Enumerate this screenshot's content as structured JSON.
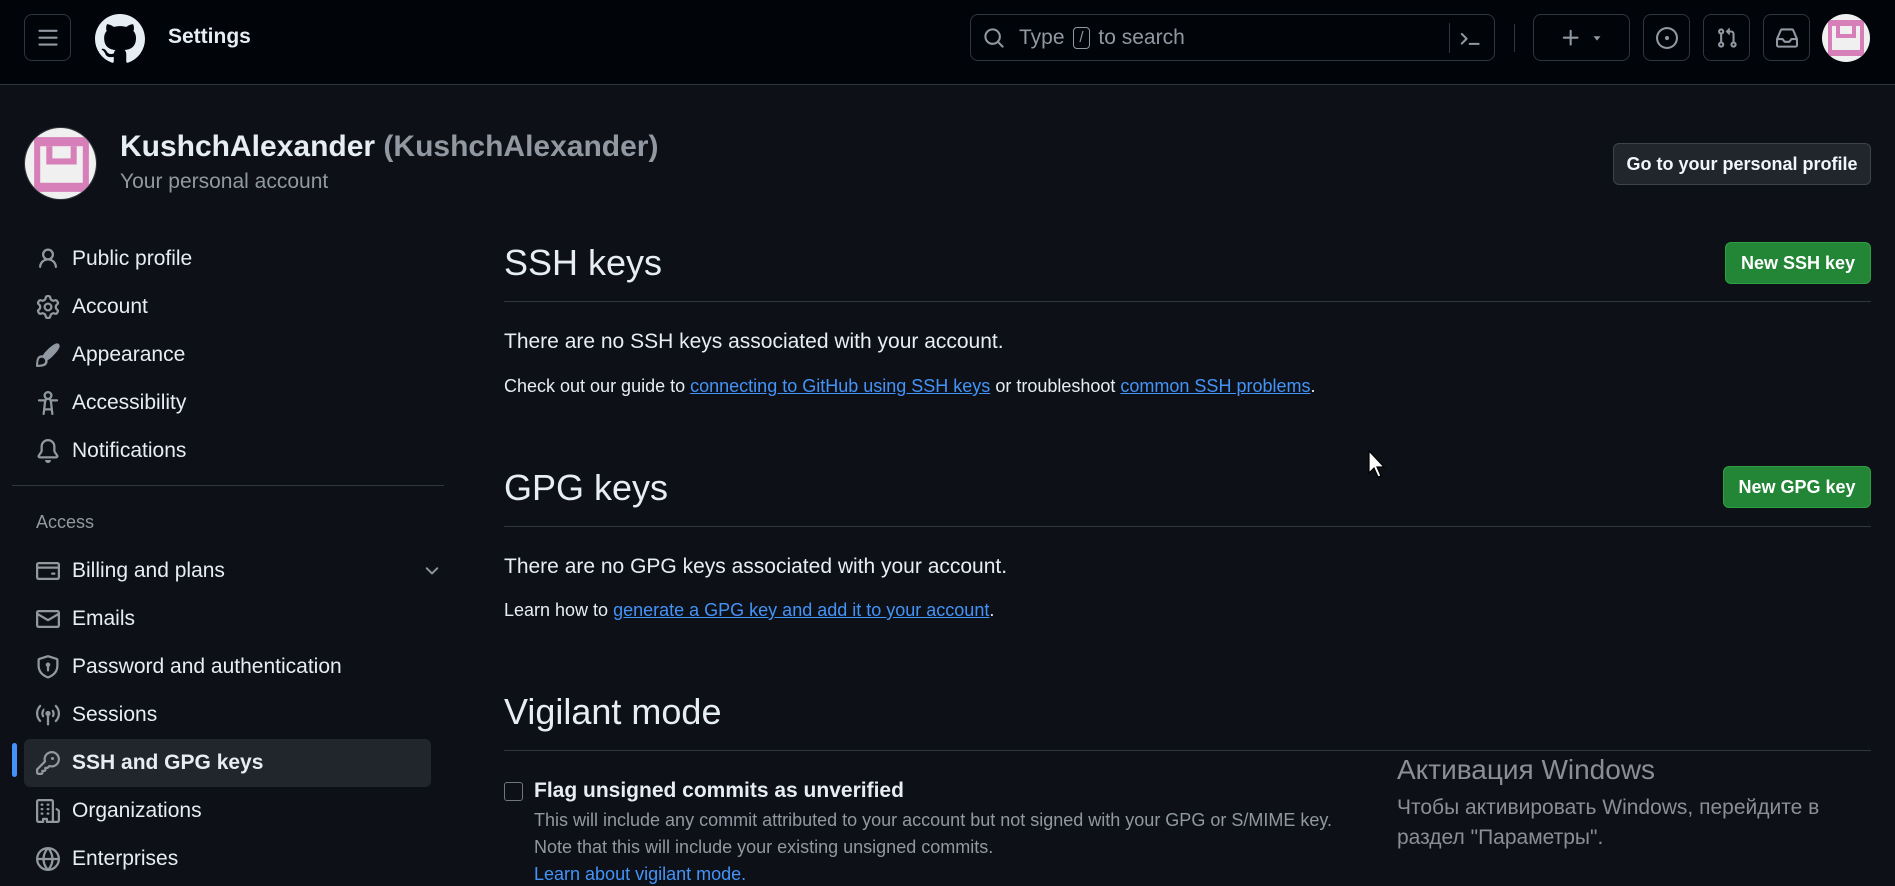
{
  "header": {
    "context_title": "Settings",
    "search": {
      "prefix": "Type",
      "key": "/",
      "suffix": "to search"
    },
    "icons": [
      "hamburger-icon",
      "github-logo",
      "search-icon",
      "command-palette-icon",
      "plus-icon",
      "chevron-down-icon",
      "issues-icon",
      "pull-requests-icon",
      "inbox-icon",
      "avatar"
    ]
  },
  "profile": {
    "name": "KushchAlexander",
    "login": "(KushchAlexander)",
    "subtitle": "Your personal account",
    "profile_button": "Go to your personal profile"
  },
  "sidebar": {
    "items": [
      {
        "label": "Public profile",
        "icon": "person-icon"
      },
      {
        "label": "Account",
        "icon": "gear-icon"
      },
      {
        "label": "Appearance",
        "icon": "paintbrush-icon"
      },
      {
        "label": "Accessibility",
        "icon": "accessibility-icon"
      },
      {
        "label": "Notifications",
        "icon": "bell-icon"
      }
    ],
    "access_heading": "Access",
    "access_items": [
      {
        "label": "Billing and plans",
        "icon": "credit-card-icon"
      },
      {
        "label": "Emails",
        "icon": "mail-icon"
      },
      {
        "label": "Password and authentication",
        "icon": "shield-lock-icon"
      },
      {
        "label": "Sessions",
        "icon": "broadcast-icon"
      },
      {
        "label": "SSH and GPG keys",
        "icon": "key-icon",
        "active": true
      },
      {
        "label": "Organizations",
        "icon": "organization-icon"
      },
      {
        "label": "Enterprises",
        "icon": "globe-icon"
      }
    ]
  },
  "ssh": {
    "title": "SSH keys",
    "new_button": "New SSH key",
    "empty": "There are no SSH keys associated with your account.",
    "guide_prefix": "Check out our guide to",
    "guide_link": "connecting to GitHub using SSH keys",
    "guide_middle": "or troubleshoot",
    "guide_link2": "common SSH problems",
    "guide_suffix": "."
  },
  "gpg": {
    "title": "GPG keys",
    "new_button": "New GPG key",
    "empty": "There are no GPG keys associated with your account.",
    "learn_prefix": "Learn how to",
    "learn_link": "generate a GPG key and add it to your account",
    "learn_suffix": "."
  },
  "vigilant": {
    "title": "Vigilant mode",
    "checkbox_label": "Flag unsigned commits as unverified",
    "checked": false,
    "note_line1": "This will include any commit attributed to your account but not signed with your GPG or S/MIME key.",
    "note_line2": "Note that this will include your existing unsigned commits.",
    "learn_link": "Learn about vigilant mode."
  },
  "watermark": {
    "title": "Активация Windows",
    "text": "Чтобы активировать Windows, перейдите в раздел \"Параметры\"."
  },
  "colors": {
    "page_bg": "#0d1117",
    "header_bg": "#010409",
    "link": "#4493f8",
    "primary_button": "#238636",
    "avatar_pink": "#d67fb8"
  }
}
